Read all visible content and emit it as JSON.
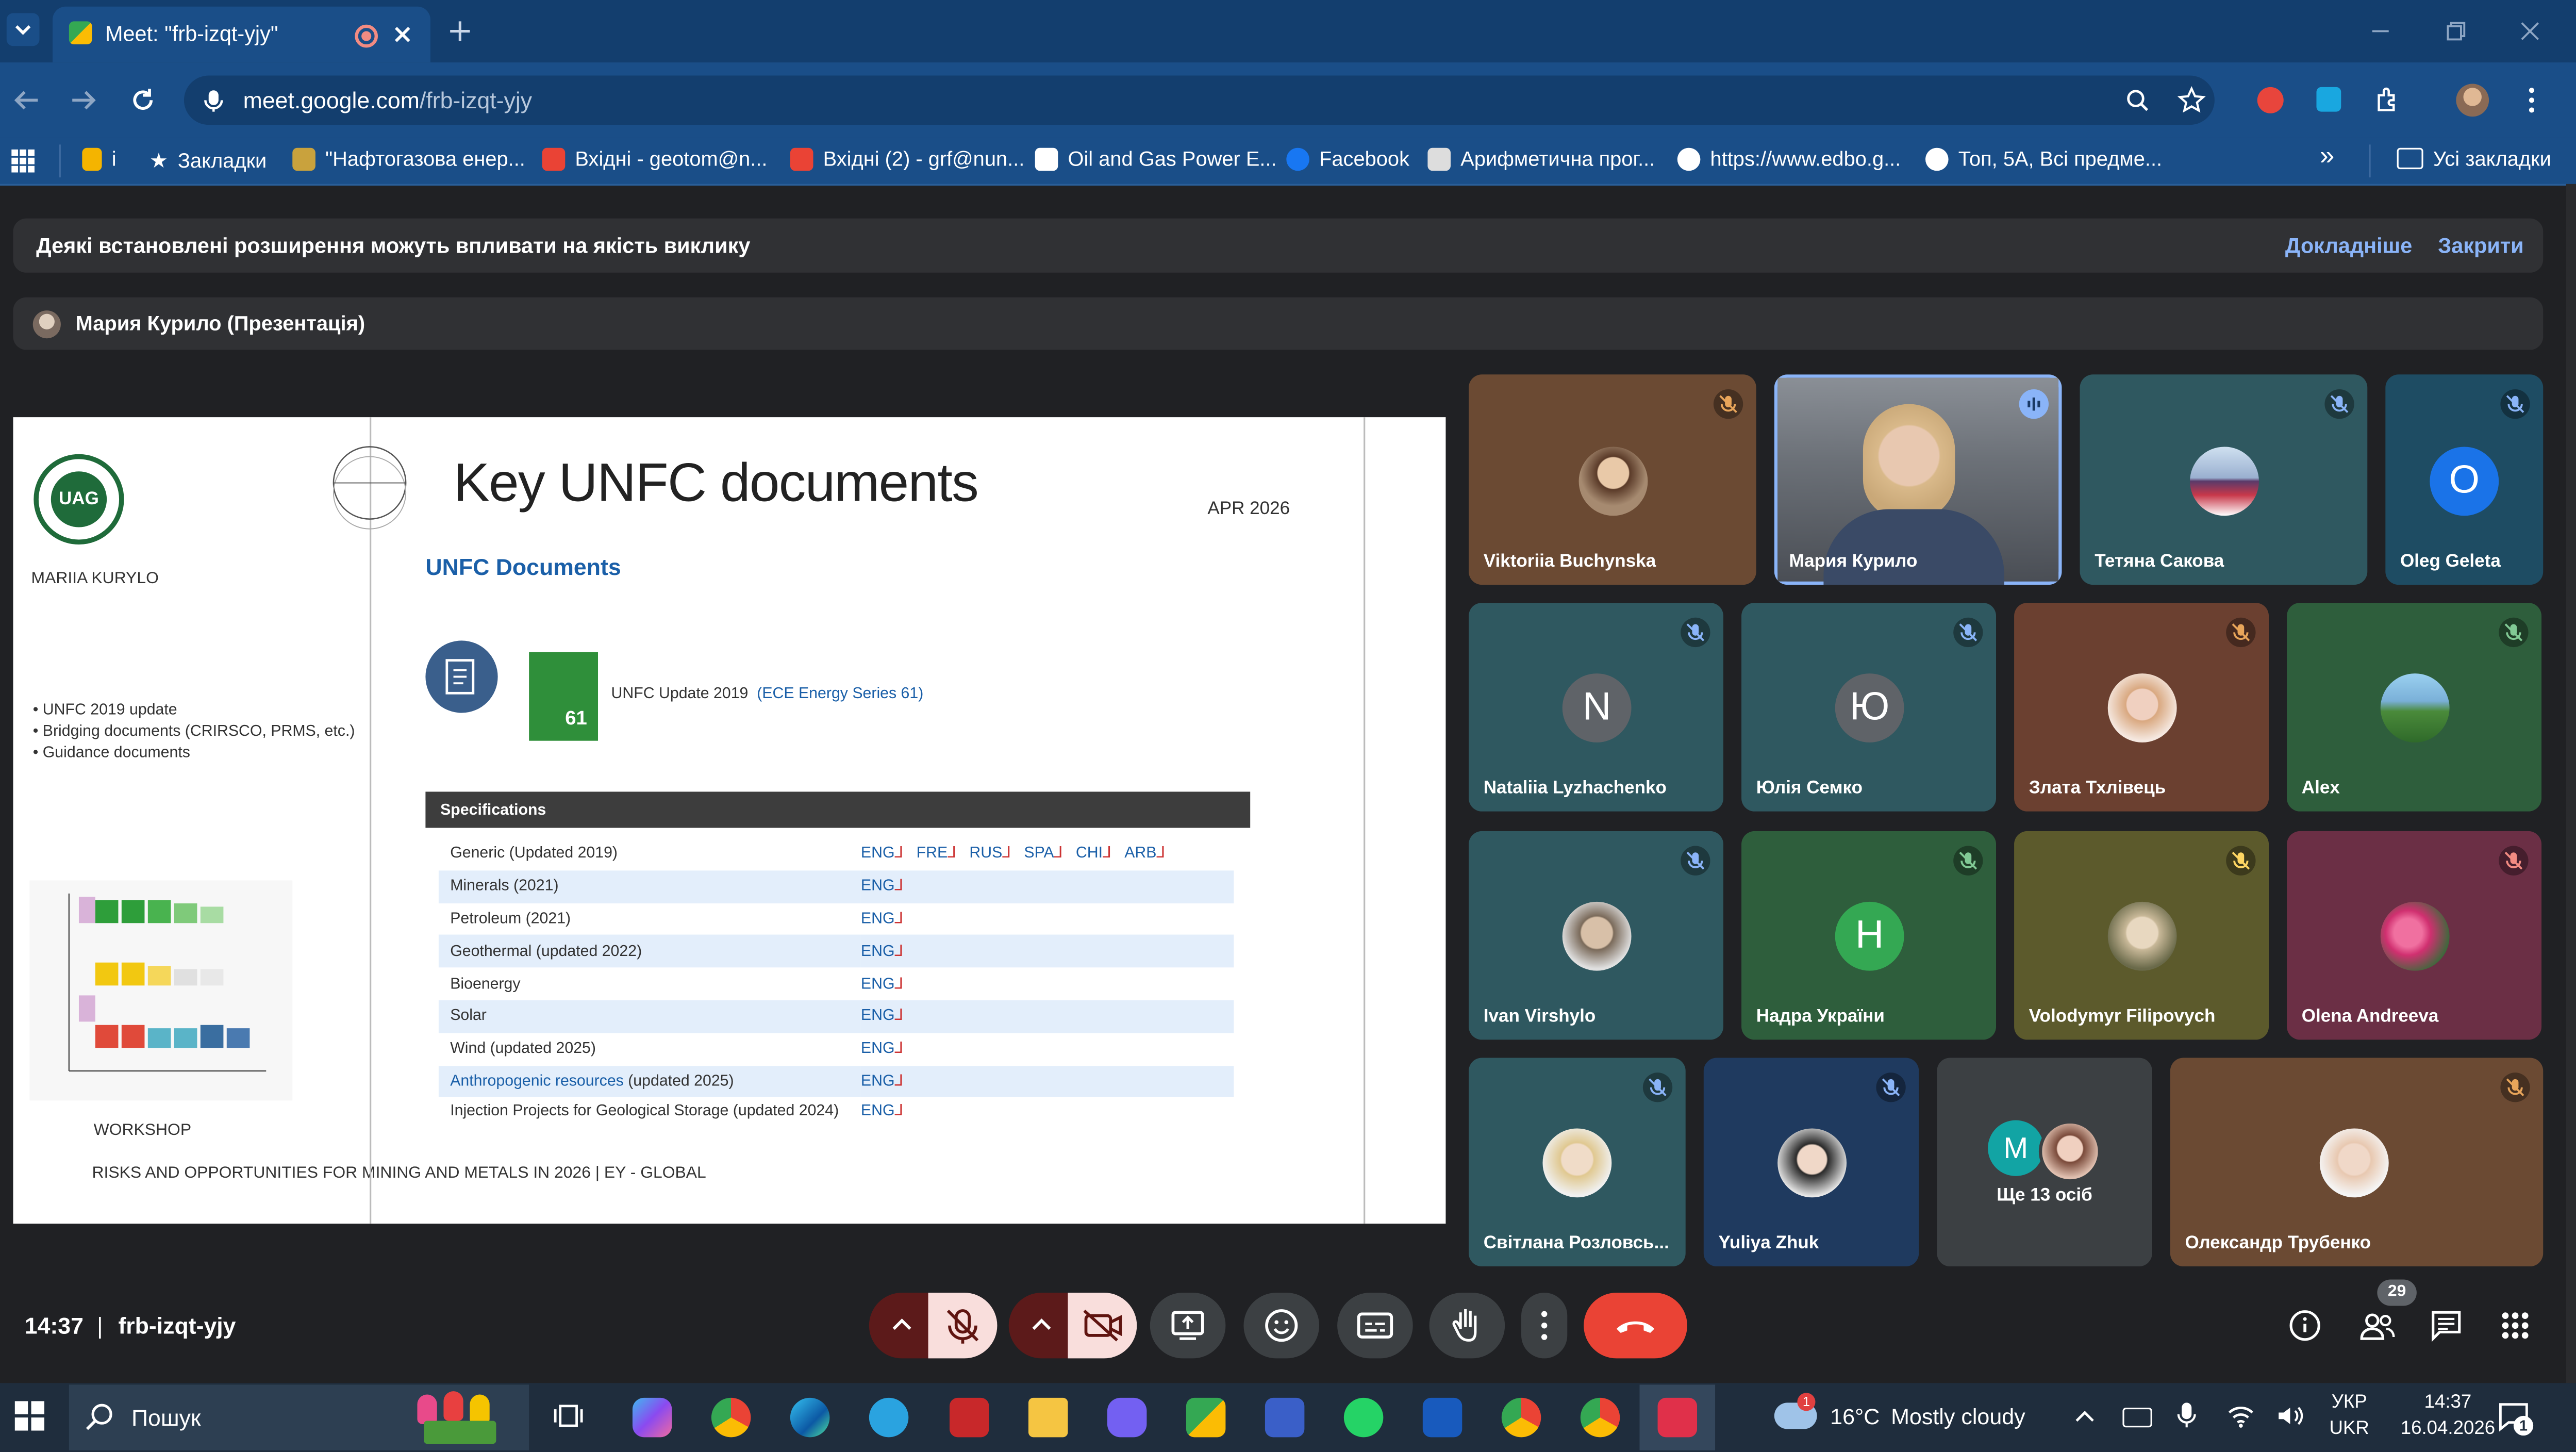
{
  "browser": {
    "tab_title": "Meet: \"frb-izqt-yjy\"",
    "url_domain": "meet.google.com",
    "url_path": "/frb-izqt-yjy",
    "bookmarks": [
      {
        "label": "i",
        "icon": "generic-icon",
        "color": "#f4b400"
      },
      {
        "label": "Закладки",
        "icon": "star-icon",
        "color": "#ffffff"
      },
      {
        "label": "\"Нафтогазова енер...",
        "icon": "site-icon",
        "color": "#f2c94c"
      },
      {
        "label": "Вхідні - geotom@n...",
        "icon": "gmail-icon",
        "color": "#ea4335"
      },
      {
        "label": "Вхідні (2) - grf@nun...",
        "icon": "gmail-icon",
        "color": "#ea4335"
      },
      {
        "label": "Oil and Gas Power E...",
        "icon": "pkt-icon",
        "color": "#ffffff"
      },
      {
        "label": "Facebook",
        "icon": "facebook-icon",
        "color": "#1877f2"
      },
      {
        "label": "Арифметична прог...",
        "icon": "site-icon",
        "color": "#ffffff"
      },
      {
        "label": "https://www.edbo.g...",
        "icon": "globe-icon",
        "color": "#ffffff"
      },
      {
        "label": "Топ, 5А, Всі предме...",
        "icon": "globe-icon",
        "color": "#ffffff"
      }
    ],
    "all_bookmarks": "Усі закладки"
  },
  "meet": {
    "banner_text": "Деякі встановлені розширення можуть впливати на якість виклику",
    "banner_learn_more": "Докладніше",
    "banner_close": "Закрити",
    "presenter_label": "Мария Курило (Презентація)",
    "time": "14:37",
    "separator": "|",
    "meeting_code": "frb-izqt-yjy",
    "people_count": "29"
  },
  "slide": {
    "logo_text": "UAG",
    "author": "MARIIA KURYLO",
    "title": "Key UNFC documents",
    "date": "APR 2026",
    "subtitle": "UNFC Documents",
    "book_number": "61",
    "update_label": "UNFC Update 2019",
    "update_link": "(ECE Energy Series 61)",
    "bullets": [
      "UNFC 2019 update",
      "Bridging documents (CRIRSCO, PRMS, etc.)",
      "Guidance documents"
    ],
    "workshop": "WORKSHOP",
    "footer": "RISKS AND OPPORTUNITIES FOR MINING AND METALS IN 2026 | EY - GLOBAL",
    "table_header": "Specifications",
    "rows": [
      {
        "name": "Generic (Updated 2019)",
        "link": "",
        "langs": [
          "ENG",
          "FRE",
          "RUS",
          "SPA",
          "CHI",
          "ARB"
        ]
      },
      {
        "name": "Minerals (2021)",
        "link": "",
        "langs": [
          "ENG"
        ]
      },
      {
        "name": "Petroleum (2021)",
        "link": "",
        "langs": [
          "ENG"
        ]
      },
      {
        "name": "Geothermal (updated 2022)",
        "link": "",
        "langs": [
          "ENG"
        ]
      },
      {
        "name": "Bioenergy",
        "link": "",
        "langs": [
          "ENG"
        ]
      },
      {
        "name": "Solar",
        "link": "",
        "langs": [
          "ENG"
        ]
      },
      {
        "name": "Wind (updated 2025)",
        "link": "",
        "langs": [
          "ENG"
        ]
      },
      {
        "name": " (updated 2025)",
        "link": "Anthropogenic resources",
        "langs": [
          "ENG"
        ]
      },
      {
        "name": "Injection Projects for Geological Storage (updated 2024)",
        "link": "",
        "langs": [
          "ENG"
        ]
      }
    ]
  },
  "participants": [
    {
      "name": "Viktoriia Buchynska",
      "bg": "#6b4a33",
      "avatar": "photo",
      "mic": "#e8a55a"
    },
    {
      "name": "Мария Курило",
      "bg": "#3b3f4a",
      "avatar": "video",
      "mic": "speaking"
    },
    {
      "name": "Тетяна Сакова",
      "bg": "#2f5860",
      "avatar": "photo",
      "mic": "#8ab4f8"
    },
    {
      "name": "Oleg Geleta",
      "bg": "#1e4c63",
      "avatar": "letter",
      "letter": "O",
      "letter_bg": "#1a73e8",
      "mic": "#8ab4f8"
    },
    {
      "name": "Nataliia Lyzhachenko",
      "bg": "#2f5860",
      "avatar": "letter",
      "letter": "N",
      "letter_bg": "#5f6368",
      "mic": "#8ab4f8"
    },
    {
      "name": "Юлія Семко",
      "bg": "#2f5860",
      "avatar": "letter",
      "letter": "Ю",
      "letter_bg": "#5f6368",
      "mic": "#8ab4f8"
    },
    {
      "name": "Злата Тхлівець",
      "bg": "#6b4030",
      "avatar": "photo",
      "mic": "#e8a55a"
    },
    {
      "name": "Alex",
      "bg": "#2e5e3c",
      "avatar": "photo",
      "mic": "#81c995"
    },
    {
      "name": "Ivan Virshylo",
      "bg": "#2f5860",
      "avatar": "photo",
      "mic": "#8ab4f8"
    },
    {
      "name": "Надра України",
      "bg": "#2e5e3c",
      "avatar": "letter",
      "letter": "H",
      "letter_bg": "#34a853",
      "mic": "#81c995"
    },
    {
      "name": "Volodymyr Filipovych",
      "bg": "#5c5a2c",
      "avatar": "photo",
      "mic": "#fdd663"
    },
    {
      "name": "Olena Andreeva",
      "bg": "#6b2f45",
      "avatar": "photo",
      "mic": "#f28b82"
    },
    {
      "name": "Світлана Розловсь...",
      "bg": "#2f5860",
      "avatar": "photo",
      "mic": "#8ab4f8"
    },
    {
      "name": "Yuliya Zhuk",
      "bg": "#1f3a5f",
      "avatar": "photo",
      "mic": "#8ab4f8"
    },
    {
      "name": "Ще 13 осіб",
      "bg": "#3c4043",
      "avatar": "group",
      "letter": "M",
      "letter_bg": "#12a4a4"
    },
    {
      "name": "Олександр Трубенко",
      "bg": "#6b4a33",
      "avatar": "photo",
      "mic": "#e8a55a"
    }
  ],
  "taskbar": {
    "search_placeholder": "Пошук",
    "weather_temp": "16°C",
    "weather_text": "Mostly cloudy",
    "lang_top": "УКР",
    "lang_bottom": "UKR",
    "clock_time": "14:37",
    "clock_date": "16.04.2026",
    "notification_count": "1",
    "weather_badge": "1"
  }
}
